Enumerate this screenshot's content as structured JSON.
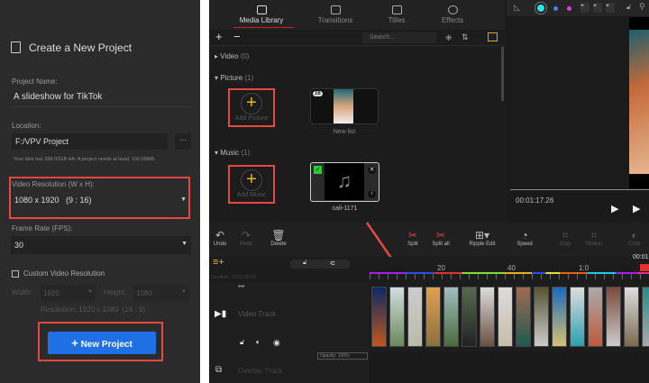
{
  "dialog": {
    "title": "Create a New Project",
    "project_name_label": "Project Name:",
    "project_name_value": "A slideshow for TikTok",
    "location_label": "Location:",
    "location_value": "F:/VPV Project",
    "browse_label": "···",
    "disk_info": "Your disk has 288.02GB left. A project needs at least: 100.00MB.",
    "resolution_label": "Video Resolution (W x H):",
    "resolution_value": "1080 x 1920   (9 : 16)",
    "frame_rate_label": "Frame Rate (FPS):",
    "frame_rate_value": "30",
    "custom_label": "Custom Video Resolution",
    "custom_checked": false,
    "width_label": "Width:",
    "width_value": "1920",
    "height_label": "Height:",
    "height_value": "1080",
    "custom_resolution_text": "Resolution: 1920 x 1080  (16 : 9)",
    "new_project_label": "New Project",
    "accent": "#1f6fe5",
    "highlight": "#e5483f"
  },
  "library": {
    "tabs": [
      {
        "label": "Media Library",
        "active": true
      },
      {
        "label": "Transitions"
      },
      {
        "label": "Titles"
      },
      {
        "label": "Effects"
      }
    ],
    "search_placeholder": "Search...",
    "sections": [
      {
        "label": "Video",
        "count": "(0)"
      },
      {
        "label": "Picture",
        "count": "(1)"
      },
      {
        "label": "Music",
        "count": "(1)"
      }
    ],
    "add_picture": "Add Picture",
    "picture_item": {
      "badge": "16",
      "label": "New list"
    },
    "add_music": "Add Music",
    "music_item": {
      "label": "cali-1171"
    }
  },
  "preview": {
    "time": "00:01:17.26",
    "dot_colors": [
      "#2ee6e6",
      "#4a7ff0",
      "#e83be8"
    ]
  },
  "toolbar": {
    "undo": "Undo",
    "redo": "Redo",
    "delete": "Delete",
    "split": "Split",
    "split_all": "Split all",
    "ripple_edit": "Ripple Edit",
    "speed": "Speed",
    "crop": "Crop",
    "motion": "Motion",
    "color": "Color"
  },
  "timeline": {
    "duration": "Duration:  00:01:00.53",
    "ticks": [
      "20",
      "40",
      "1:0"
    ],
    "playhead_time": "00:01",
    "video_track": "Video Track",
    "overlay_track": "Overlay Track",
    "opacity": "Opacity: 100%",
    "more": "•••"
  }
}
